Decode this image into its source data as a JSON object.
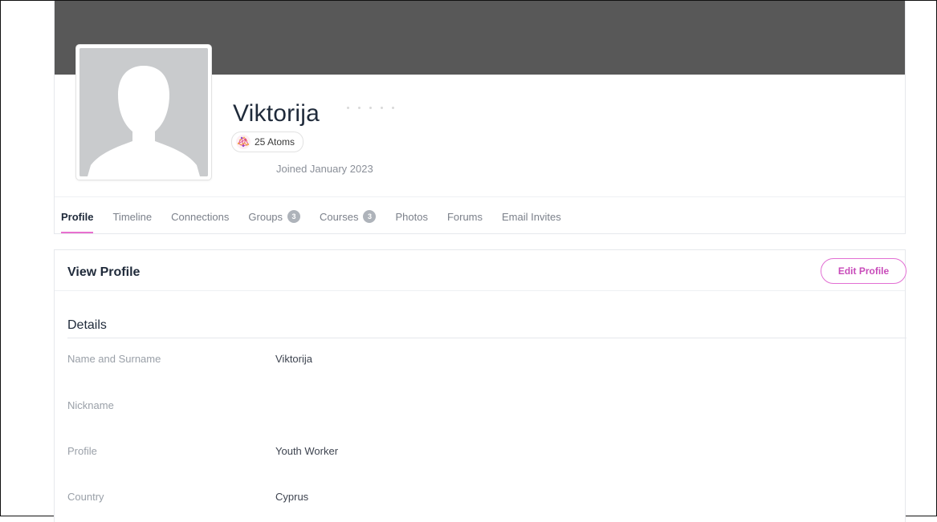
{
  "profile": {
    "name": "Viktorija",
    "atoms_label": "25 Atoms",
    "joined": "Joined January 2023"
  },
  "tabs": [
    {
      "label": "Profile",
      "active": true
    },
    {
      "label": "Timeline"
    },
    {
      "label": "Connections"
    },
    {
      "label": "Groups",
      "count": "3"
    },
    {
      "label": "Courses",
      "count": "3"
    },
    {
      "label": "Photos"
    },
    {
      "label": "Forums"
    },
    {
      "label": "Email Invites"
    }
  ],
  "view_profile": {
    "title": "View Profile",
    "edit_label": "Edit Profile",
    "details_heading": "Details",
    "fields": [
      {
        "label": "Name and Surname",
        "value": "Viktorija"
      },
      {
        "label": "Nickname",
        "value": ""
      },
      {
        "label": "Profile",
        "value": "Youth Worker"
      },
      {
        "label": "Country",
        "value": "Cyprus"
      }
    ]
  },
  "colors": {
    "cover": "#585858",
    "accent": "#e86fcf",
    "avatar_placeholder": "#c9cbcd"
  },
  "icons": {
    "atoms": "atom-network-icon",
    "avatar": "default-user-silhouette"
  }
}
